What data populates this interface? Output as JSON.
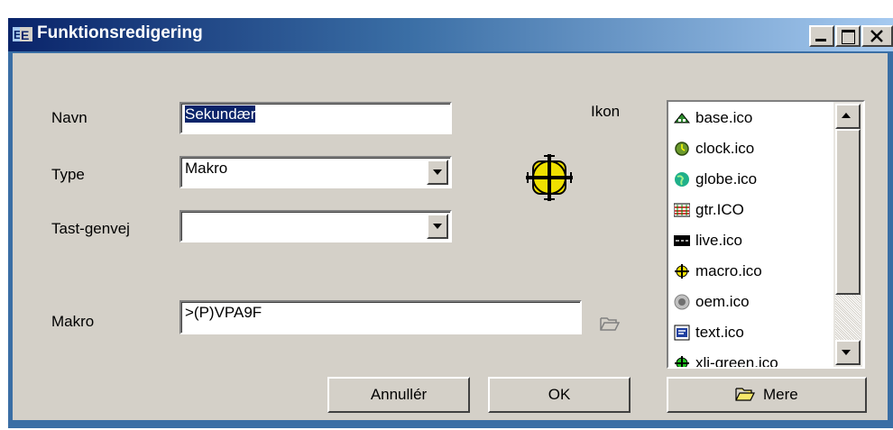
{
  "window": {
    "title": "Funktionsredigering"
  },
  "form": {
    "name_label": "Navn",
    "name_value": "Sekundær",
    "type_label": "Type",
    "type_value": "Makro",
    "shortcut_label": "Tast-genvej",
    "shortcut_value": "",
    "macro_label": "Makro",
    "macro_value": ">(P)VPA9F",
    "icon_label": "Ikon"
  },
  "icon_list": {
    "items": [
      {
        "label": "base.ico",
        "icon": "base-icon"
      },
      {
        "label": "clock.ico",
        "icon": "clock-icon"
      },
      {
        "label": "globe.ico",
        "icon": "globe-icon"
      },
      {
        "label": "gtr.ICO",
        "icon": "gtr-icon"
      },
      {
        "label": "live.ico",
        "icon": "live-icon"
      },
      {
        "label": "macro.ico",
        "icon": "macro-icon"
      },
      {
        "label": "oem.ico",
        "icon": "oem-icon"
      },
      {
        "label": "text.ico",
        "icon": "text-icon"
      },
      {
        "label": "xli-green.ico",
        "icon": "xli-green-icon"
      }
    ]
  },
  "buttons": {
    "cancel": "Annullér",
    "ok": "OK",
    "more": "Mere"
  },
  "colors": {
    "titlebar_start": "#0a246a",
    "titlebar_end": "#a6caf0",
    "face": "#d4d0c8",
    "selection": "#0a246a"
  }
}
